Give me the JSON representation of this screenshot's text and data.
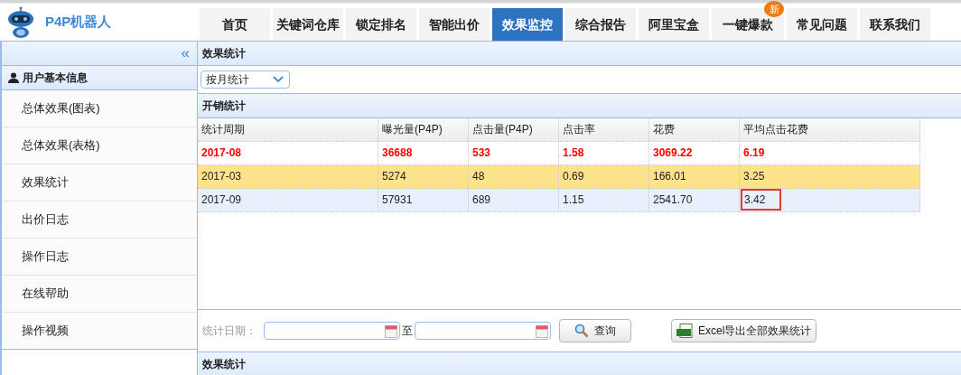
{
  "logo": {
    "title": "P4P机器人"
  },
  "tabs": [
    {
      "label": "首页",
      "selected": false
    },
    {
      "label": "关键词仓库",
      "selected": false
    },
    {
      "label": "锁定排名",
      "selected": false
    },
    {
      "label": "智能出价",
      "selected": false
    },
    {
      "label": "效果监控",
      "selected": true
    },
    {
      "label": "综合报告",
      "selected": false
    },
    {
      "label": "阿里宝盒",
      "selected": false
    },
    {
      "label": "一键爆款",
      "selected": false,
      "badge": "新"
    },
    {
      "label": "常见问题",
      "selected": false
    },
    {
      "label": "联系我们",
      "selected": false
    }
  ],
  "sidebar": {
    "collapse": "«",
    "section": "用户基本信息",
    "items": [
      "总体效果(图表)",
      "总体效果(表格)",
      "效果统计",
      "出价日志",
      "操作日志",
      "在线帮助",
      "操作视频"
    ]
  },
  "main": {
    "title": "效果统计",
    "period_select": {
      "value": "按月统计"
    },
    "table_title": "开销统计",
    "table": {
      "columns": [
        "统计周期",
        "曝光量(P4P)",
        "点击量(P4P)",
        "点击率",
        "花费",
        "平均点击花费"
      ],
      "rows": [
        {
          "kind": "total",
          "cells": [
            {
              "text": "2017-08",
              "outlined": false
            },
            {
              "text": "36688",
              "outlined": false
            },
            {
              "text": "533",
              "outlined": false
            },
            {
              "text": "1.58",
              "outlined": false
            },
            {
              "text": "3069.22",
              "outlined": false
            },
            {
              "text": "6.19",
              "outlined": false
            }
          ]
        },
        {
          "kind": "highlight",
          "cells": [
            {
              "text": "2017-03",
              "outlined": false
            },
            {
              "text": "5274",
              "outlined": false
            },
            {
              "text": "48",
              "outlined": false
            },
            {
              "text": "0.69",
              "outlined": false
            },
            {
              "text": "166.01",
              "outlined": false
            },
            {
              "text": "3.25",
              "outlined": false
            }
          ]
        },
        {
          "kind": "normal",
          "cells": [
            {
              "text": "2017-09",
              "outlined": false
            },
            {
              "text": "57931",
              "outlined": false
            },
            {
              "text": "689",
              "outlined": false
            },
            {
              "text": "1.15",
              "outlined": false
            },
            {
              "text": "2541.70",
              "outlined": false
            },
            {
              "text": "3.42",
              "outlined": true
            }
          ]
        }
      ]
    },
    "date_label": "统计日期：",
    "date_separator": "至",
    "query_button": "查询",
    "export_button": "Excel导出全部效果统计"
  },
  "bottom_title": "效果统计"
}
